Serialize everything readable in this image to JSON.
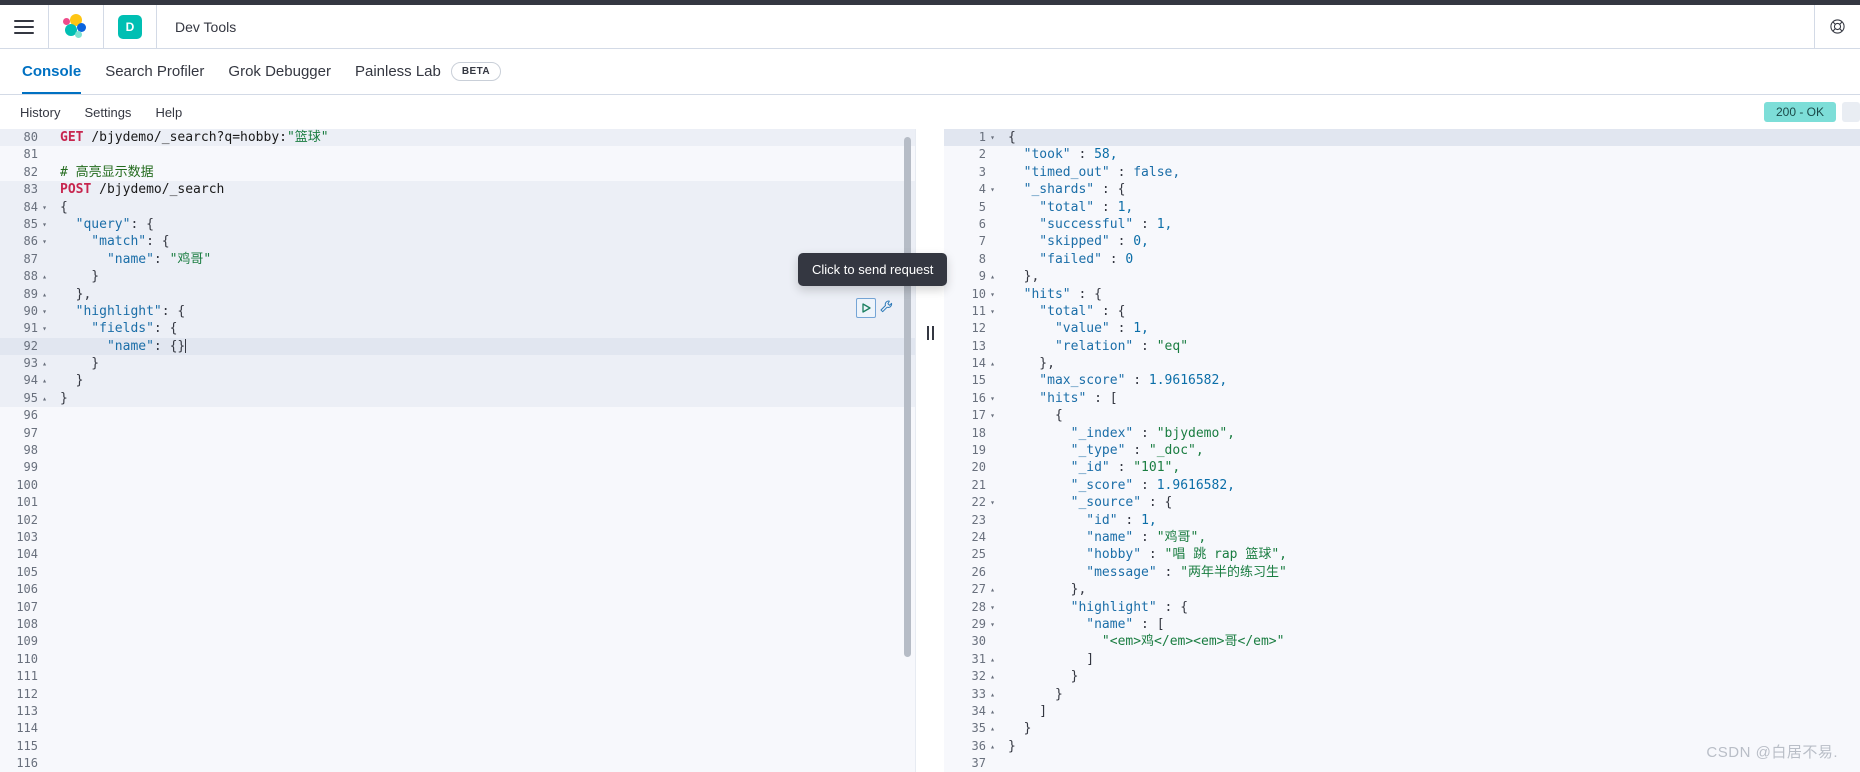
{
  "header": {
    "menu_icon": "hamburger-menu-icon",
    "logo_icon": "elastic-logo-icon",
    "space_initial": "D",
    "app_title": "Dev Tools",
    "help_icon": "help-lifering-icon"
  },
  "tabs": [
    {
      "label": "Console",
      "active": true
    },
    {
      "label": "Search Profiler",
      "active": false
    },
    {
      "label": "Grok Debugger",
      "active": false
    },
    {
      "label": "Painless Lab",
      "active": false,
      "badge": "BETA"
    }
  ],
  "console_menu": [
    {
      "label": "History"
    },
    {
      "label": "Settings"
    },
    {
      "label": "Help"
    }
  ],
  "status": {
    "text": "200 - OK",
    "color": "#7dded8"
  },
  "tooltip": {
    "text": "Click to send request"
  },
  "actions": {
    "play_icon": "play-triangle-icon",
    "wrench_icon": "wrench-icon"
  },
  "editor": {
    "first_line_number": 80,
    "active_line": 92,
    "lines": [
      {
        "n": 80,
        "fold": "",
        "inreq": true,
        "tokens": [
          {
            "c": "t-method",
            "t": "GET"
          },
          {
            "c": "t-punc",
            "t": " "
          },
          {
            "c": "t-url",
            "t": "/bjydemo/_search?q=hobby:"
          },
          {
            "c": "t-str",
            "t": "\"篮球\""
          }
        ]
      },
      {
        "n": 81,
        "fold": "",
        "tokens": []
      },
      {
        "n": 82,
        "fold": "",
        "tokens": [
          {
            "c": "t-comment",
            "t": "# 高亮显示数据"
          }
        ]
      },
      {
        "n": 83,
        "fold": "",
        "inreq": true,
        "tokens": [
          {
            "c": "t-method",
            "t": "POST"
          },
          {
            "c": "t-punc",
            "t": " "
          },
          {
            "c": "t-url",
            "t": "/bjydemo/_search"
          }
        ]
      },
      {
        "n": 84,
        "fold": "▾",
        "inreq": true,
        "tokens": [
          {
            "c": "t-brace",
            "t": "{"
          }
        ]
      },
      {
        "n": 85,
        "fold": "▾",
        "inreq": true,
        "tokens": [
          {
            "c": "t-key",
            "t": "  \"query\""
          },
          {
            "c": "t-punc",
            "t": ": "
          },
          {
            "c": "t-brace",
            "t": "{"
          }
        ]
      },
      {
        "n": 86,
        "fold": "▾",
        "inreq": true,
        "tokens": [
          {
            "c": "t-key",
            "t": "    \"match\""
          },
          {
            "c": "t-punc",
            "t": ": "
          },
          {
            "c": "t-brace",
            "t": "{"
          }
        ]
      },
      {
        "n": 87,
        "fold": "",
        "inreq": true,
        "tokens": [
          {
            "c": "t-key",
            "t": "      \"name\""
          },
          {
            "c": "t-punc",
            "t": ": "
          },
          {
            "c": "t-str",
            "t": "\"鸡哥\""
          }
        ]
      },
      {
        "n": 88,
        "fold": "▴",
        "inreq": true,
        "tokens": [
          {
            "c": "t-brace",
            "t": "    }"
          }
        ]
      },
      {
        "n": 89,
        "fold": "▴",
        "inreq": true,
        "tokens": [
          {
            "c": "t-brace",
            "t": "  },"
          }
        ]
      },
      {
        "n": 90,
        "fold": "▾",
        "inreq": true,
        "tokens": [
          {
            "c": "t-key",
            "t": "  \"highlight\""
          },
          {
            "c": "t-punc",
            "t": ": "
          },
          {
            "c": "t-brace",
            "t": "{"
          }
        ]
      },
      {
        "n": 91,
        "fold": "▾",
        "inreq": true,
        "tokens": [
          {
            "c": "t-key",
            "t": "    \"fields\""
          },
          {
            "c": "t-punc",
            "t": ": "
          },
          {
            "c": "t-brace",
            "t": "{"
          }
        ]
      },
      {
        "n": 92,
        "fold": "",
        "inreq": true,
        "active": true,
        "cursor": true,
        "tokens": [
          {
            "c": "t-key",
            "t": "      \"name\""
          },
          {
            "c": "t-punc",
            "t": ": "
          },
          {
            "c": "t-brace",
            "t": "{}"
          }
        ]
      },
      {
        "n": 93,
        "fold": "▴",
        "inreq": true,
        "tokens": [
          {
            "c": "t-brace",
            "t": "    }"
          }
        ]
      },
      {
        "n": 94,
        "fold": "▴",
        "inreq": true,
        "tokens": [
          {
            "c": "t-brace",
            "t": "  }"
          }
        ]
      },
      {
        "n": 95,
        "fold": "▴",
        "inreq": true,
        "tokens": [
          {
            "c": "t-brace",
            "t": "}"
          }
        ]
      },
      {
        "n": 96,
        "fold": "",
        "tokens": []
      },
      {
        "n": 97,
        "fold": "",
        "tokens": []
      },
      {
        "n": 98,
        "fold": "",
        "tokens": []
      },
      {
        "n": 99,
        "fold": "",
        "tokens": []
      },
      {
        "n": 100,
        "fold": "",
        "tokens": []
      },
      {
        "n": 101,
        "fold": "",
        "tokens": []
      },
      {
        "n": 102,
        "fold": "",
        "tokens": []
      },
      {
        "n": 103,
        "fold": "",
        "tokens": []
      },
      {
        "n": 104,
        "fold": "",
        "tokens": []
      },
      {
        "n": 105,
        "fold": "",
        "tokens": []
      },
      {
        "n": 106,
        "fold": "",
        "tokens": []
      },
      {
        "n": 107,
        "fold": "",
        "tokens": []
      },
      {
        "n": 108,
        "fold": "",
        "tokens": []
      },
      {
        "n": 109,
        "fold": "",
        "tokens": []
      },
      {
        "n": 110,
        "fold": "",
        "tokens": []
      },
      {
        "n": 111,
        "fold": "",
        "tokens": []
      },
      {
        "n": 112,
        "fold": "",
        "tokens": []
      },
      {
        "n": 113,
        "fold": "",
        "tokens": []
      },
      {
        "n": 114,
        "fold": "",
        "tokens": []
      },
      {
        "n": 115,
        "fold": "",
        "tokens": []
      },
      {
        "n": 116,
        "fold": "",
        "tokens": []
      }
    ]
  },
  "response": {
    "lines": [
      {
        "n": 1,
        "fold": "▾",
        "active": true,
        "tokens": [
          {
            "c": "t-brace",
            "t": "{"
          }
        ]
      },
      {
        "n": 2,
        "fold": "",
        "tokens": [
          {
            "c": "t-key",
            "t": "  \"took\""
          },
          {
            "c": "t-punc",
            "t": " : "
          },
          {
            "c": "t-num",
            "t": "58,"
          }
        ]
      },
      {
        "n": 3,
        "fold": "",
        "tokens": [
          {
            "c": "t-key",
            "t": "  \"timed_out\""
          },
          {
            "c": "t-punc",
            "t": " : "
          },
          {
            "c": "t-bool",
            "t": "false,"
          }
        ]
      },
      {
        "n": 4,
        "fold": "▾",
        "tokens": [
          {
            "c": "t-key",
            "t": "  \"_shards\""
          },
          {
            "c": "t-punc",
            "t": " : "
          },
          {
            "c": "t-brace",
            "t": "{"
          }
        ]
      },
      {
        "n": 5,
        "fold": "",
        "tokens": [
          {
            "c": "t-key",
            "t": "    \"total\""
          },
          {
            "c": "t-punc",
            "t": " : "
          },
          {
            "c": "t-num",
            "t": "1,"
          }
        ]
      },
      {
        "n": 6,
        "fold": "",
        "tokens": [
          {
            "c": "t-key",
            "t": "    \"successful\""
          },
          {
            "c": "t-punc",
            "t": " : "
          },
          {
            "c": "t-num",
            "t": "1,"
          }
        ]
      },
      {
        "n": 7,
        "fold": "",
        "tokens": [
          {
            "c": "t-key",
            "t": "    \"skipped\""
          },
          {
            "c": "t-punc",
            "t": " : "
          },
          {
            "c": "t-num",
            "t": "0,"
          }
        ]
      },
      {
        "n": 8,
        "fold": "",
        "tokens": [
          {
            "c": "t-key",
            "t": "    \"failed\""
          },
          {
            "c": "t-punc",
            "t": " : "
          },
          {
            "c": "t-num",
            "t": "0"
          }
        ]
      },
      {
        "n": 9,
        "fold": "▴",
        "tokens": [
          {
            "c": "t-brace",
            "t": "  },"
          }
        ]
      },
      {
        "n": 10,
        "fold": "▾",
        "tokens": [
          {
            "c": "t-key",
            "t": "  \"hits\""
          },
          {
            "c": "t-punc",
            "t": " : "
          },
          {
            "c": "t-brace",
            "t": "{"
          }
        ]
      },
      {
        "n": 11,
        "fold": "▾",
        "tokens": [
          {
            "c": "t-key",
            "t": "    \"total\""
          },
          {
            "c": "t-punc",
            "t": " : "
          },
          {
            "c": "t-brace",
            "t": "{"
          }
        ]
      },
      {
        "n": 12,
        "fold": "",
        "tokens": [
          {
            "c": "t-key",
            "t": "      \"value\""
          },
          {
            "c": "t-punc",
            "t": " : "
          },
          {
            "c": "t-num",
            "t": "1,"
          }
        ]
      },
      {
        "n": 13,
        "fold": "",
        "tokens": [
          {
            "c": "t-key",
            "t": "      \"relation\""
          },
          {
            "c": "t-punc",
            "t": " : "
          },
          {
            "c": "t-str",
            "t": "\"eq\""
          }
        ]
      },
      {
        "n": 14,
        "fold": "▴",
        "tokens": [
          {
            "c": "t-brace",
            "t": "    },"
          }
        ]
      },
      {
        "n": 15,
        "fold": "",
        "tokens": [
          {
            "c": "t-key",
            "t": "    \"max_score\""
          },
          {
            "c": "t-punc",
            "t": " : "
          },
          {
            "c": "t-num",
            "t": "1.9616582,"
          }
        ]
      },
      {
        "n": 16,
        "fold": "▾",
        "tokens": [
          {
            "c": "t-key",
            "t": "    \"hits\""
          },
          {
            "c": "t-punc",
            "t": " : "
          },
          {
            "c": "t-brace",
            "t": "["
          }
        ]
      },
      {
        "n": 17,
        "fold": "▾",
        "tokens": [
          {
            "c": "t-brace",
            "t": "      {"
          }
        ]
      },
      {
        "n": 18,
        "fold": "",
        "tokens": [
          {
            "c": "t-key",
            "t": "        \"_index\""
          },
          {
            "c": "t-punc",
            "t": " : "
          },
          {
            "c": "t-str",
            "t": "\"bjydemo\","
          }
        ]
      },
      {
        "n": 19,
        "fold": "",
        "tokens": [
          {
            "c": "t-key",
            "t": "        \"_type\""
          },
          {
            "c": "t-punc",
            "t": " : "
          },
          {
            "c": "t-str",
            "t": "\"_doc\","
          }
        ]
      },
      {
        "n": 20,
        "fold": "",
        "tokens": [
          {
            "c": "t-key",
            "t": "        \"_id\""
          },
          {
            "c": "t-punc",
            "t": " : "
          },
          {
            "c": "t-str",
            "t": "\"101\","
          }
        ]
      },
      {
        "n": 21,
        "fold": "",
        "tokens": [
          {
            "c": "t-key",
            "t": "        \"_score\""
          },
          {
            "c": "t-punc",
            "t": " : "
          },
          {
            "c": "t-num",
            "t": "1.9616582,"
          }
        ]
      },
      {
        "n": 22,
        "fold": "▾",
        "tokens": [
          {
            "c": "t-key",
            "t": "        \"_source\""
          },
          {
            "c": "t-punc",
            "t": " : "
          },
          {
            "c": "t-brace",
            "t": "{"
          }
        ]
      },
      {
        "n": 23,
        "fold": "",
        "tokens": [
          {
            "c": "t-key",
            "t": "          \"id\""
          },
          {
            "c": "t-punc",
            "t": " : "
          },
          {
            "c": "t-num",
            "t": "1,"
          }
        ]
      },
      {
        "n": 24,
        "fold": "",
        "tokens": [
          {
            "c": "t-key",
            "t": "          \"name\""
          },
          {
            "c": "t-punc",
            "t": " : "
          },
          {
            "c": "t-str",
            "t": "\"鸡哥\","
          }
        ]
      },
      {
        "n": 25,
        "fold": "",
        "tokens": [
          {
            "c": "t-key",
            "t": "          \"hobby\""
          },
          {
            "c": "t-punc",
            "t": " : "
          },
          {
            "c": "t-str",
            "t": "\"唱 跳 rap 篮球\","
          }
        ]
      },
      {
        "n": 26,
        "fold": "",
        "tokens": [
          {
            "c": "t-key",
            "t": "          \"message\""
          },
          {
            "c": "t-punc",
            "t": " : "
          },
          {
            "c": "t-str",
            "t": "\"两年半的练习生\""
          }
        ]
      },
      {
        "n": 27,
        "fold": "▴",
        "tokens": [
          {
            "c": "t-brace",
            "t": "        },"
          }
        ]
      },
      {
        "n": 28,
        "fold": "▾",
        "tokens": [
          {
            "c": "t-key",
            "t": "        \"highlight\""
          },
          {
            "c": "t-punc",
            "t": " : "
          },
          {
            "c": "t-brace",
            "t": "{"
          }
        ]
      },
      {
        "n": 29,
        "fold": "▾",
        "tokens": [
          {
            "c": "t-key",
            "t": "          \"name\""
          },
          {
            "c": "t-punc",
            "t": " : "
          },
          {
            "c": "t-brace",
            "t": "["
          }
        ]
      },
      {
        "n": 30,
        "fold": "",
        "tokens": [
          {
            "c": "t-str",
            "t": "            \"<em>鸡</em><em>哥</em>\""
          }
        ]
      },
      {
        "n": 31,
        "fold": "▴",
        "tokens": [
          {
            "c": "t-brace",
            "t": "          ]"
          }
        ]
      },
      {
        "n": 32,
        "fold": "▴",
        "tokens": [
          {
            "c": "t-brace",
            "t": "        }"
          }
        ]
      },
      {
        "n": 33,
        "fold": "▴",
        "tokens": [
          {
            "c": "t-brace",
            "t": "      }"
          }
        ]
      },
      {
        "n": 34,
        "fold": "▴",
        "tokens": [
          {
            "c": "t-brace",
            "t": "    ]"
          }
        ]
      },
      {
        "n": 35,
        "fold": "▴",
        "tokens": [
          {
            "c": "t-brace",
            "t": "  }"
          }
        ]
      },
      {
        "n": 36,
        "fold": "▴",
        "tokens": [
          {
            "c": "t-brace",
            "t": "}"
          }
        ]
      },
      {
        "n": 37,
        "fold": "",
        "tokens": []
      }
    ]
  },
  "watermark": {
    "text": "CSDN @白居不易."
  }
}
